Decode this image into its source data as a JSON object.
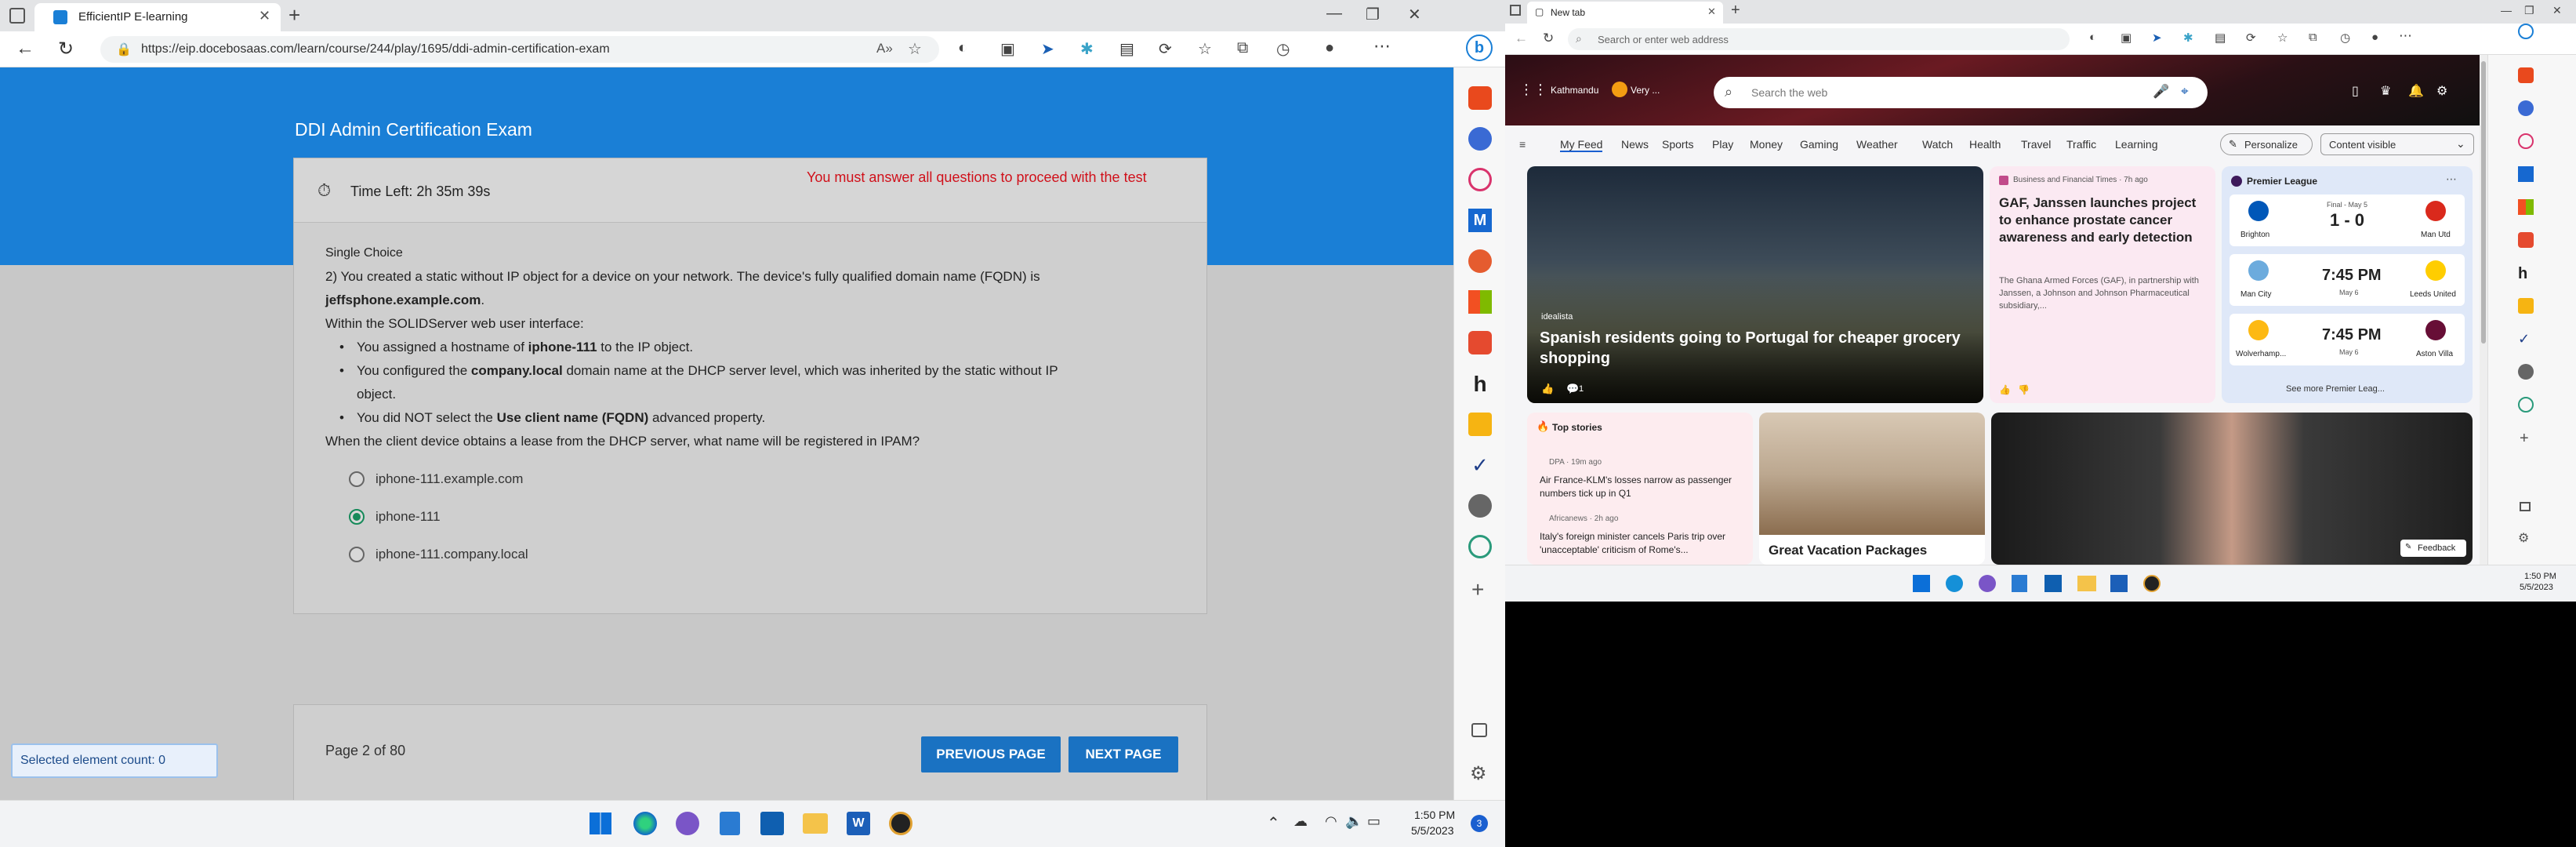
{
  "left_browser": {
    "tab_title": "EfficientIP E-learning",
    "url": "https://eip.docebosaas.com/learn/course/244/play/1695/ddi-admin-certification-exam",
    "page": {
      "exam_title": "DDI Admin Certification Exam",
      "time_left": "Time Left: 2h 35m 39s",
      "warning": "You must answer all questions to proceed with the test",
      "question_type": "Single Choice",
      "question_intro": "2) You created a static without IP object for a device on your network. The device's fully qualified domain name (FQDN) is",
      "fqdn": "jeffsphone.example.com",
      "fqdn_suffix": ".",
      "context_line": "Within the SOLIDServer web user interface:",
      "bullet1_pre": "You assigned a hostname of ",
      "bullet1_bold": "iphone-111",
      "bullet1_post": " to the IP object.",
      "bullet2_pre": "You configured the ",
      "bullet2_bold": "company.local",
      "bullet2_post": " domain name at the DHCP server level, which was inherited by the static without IP",
      "bullet2_cont": "object.",
      "bullet3_pre": "You did NOT select the ",
      "bullet3_bold": "Use client name (FQDN)",
      "bullet3_post": " advanced property.",
      "question": "When the client device obtains a lease from the DHCP server, what name will be registered in IPAM?",
      "options": [
        "iphone-111.example.com",
        "iphone-111",
        "iphone-111.company.local"
      ],
      "selected_option": "iphone-111",
      "page_indicator": "Page 2 of 80",
      "previous_label": "PREVIOUS PAGE",
      "next_label": "NEXT PAGE",
      "selected_count": "Selected element count: 0"
    }
  },
  "right_browser": {
    "tab_title": "New tab",
    "address_placeholder": "Search or enter web address",
    "location": "Kathmandu",
    "weather": "Very ...",
    "search_placeholder": "Search the web",
    "nav": [
      "My Feed",
      "News",
      "Sports",
      "Play",
      "Money",
      "Gaming",
      "Weather",
      "Watch",
      "Health",
      "Travel",
      "Traffic",
      "Learning"
    ],
    "personalize": "Personalize",
    "content_visible": "Content visible",
    "hero": {
      "source": "idealista",
      "headline": "Spanish residents going to Portugal for cheaper grocery shopping",
      "comments": "1"
    },
    "article2": {
      "source": "Business and Financial Times · 7h ago",
      "headline": "GAF, Janssen launches project to enhance prostate cancer awareness and early detection",
      "snippet": "The Ghana Armed Forces (GAF), in partnership with Janssen, a Johnson and Johnson Pharmaceutical subsidiary,..."
    },
    "league": {
      "name": "Premier League",
      "matches": [
        {
          "home": "Brighton",
          "away": "Man Utd",
          "status": "Final - May 5",
          "score": "1 - 0"
        },
        {
          "home": "Man City",
          "away": "Leeds United",
          "status": "7:45 PM",
          "date": "May 6"
        },
        {
          "home": "Wolverhamp...",
          "away": "Aston Villa",
          "status": "7:45 PM",
          "date": "May 6"
        }
      ],
      "more": "See more Premier Leag..."
    },
    "top_stories": {
      "title": "Top stories",
      "items": [
        {
          "source": "DPA · 19m ago",
          "headline": "Air France-KLM's losses narrow as passenger numbers tick up in Q1"
        },
        {
          "source": "Africanews · 2h ago",
          "headline": "Italy's foreign minister cancels Paris trip over 'unacceptable' criticism of Rome's..."
        }
      ]
    },
    "vacation": "Great Vacation Packages",
    "feedback": "Feedback",
    "time": "1:50 PM",
    "date": "5/5/2023"
  },
  "system": {
    "time": "1:50 PM",
    "date": "5/5/2023",
    "notifications": "3"
  }
}
